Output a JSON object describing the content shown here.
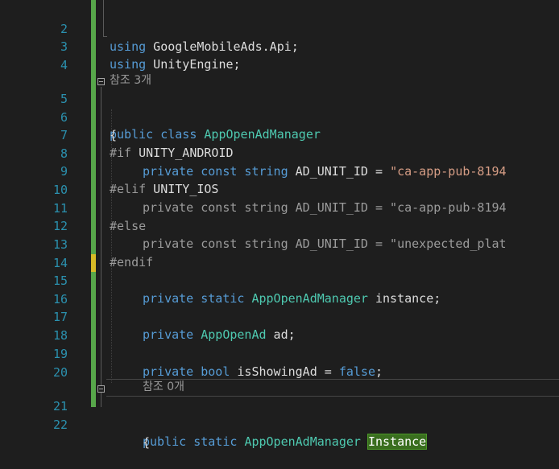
{
  "colors": {
    "background": "#1e1e1e",
    "line_number": "#2b91af",
    "keyword": "#569cd6",
    "type": "#4ec9b0",
    "string": "#d69d85",
    "preprocessor": "#9b9b9b",
    "saved_change": "#57a64a",
    "unsaved_change": "#d7ba26",
    "highlight": "#3a6e1f"
  },
  "editor": {
    "line_numbers": [
      "2",
      "3",
      "4",
      "5",
      "6",
      "7",
      "8",
      "9",
      "10",
      "11",
      "12",
      "13",
      "14",
      "15",
      "16",
      "17",
      "18",
      "19",
      "20",
      "21",
      "22"
    ],
    "ref_count_3": "참조 3개",
    "ref_count_0": "참조 0개",
    "l2": {
      "kw": "using",
      "rest": " GoogleMobileAds.Api;"
    },
    "l3": {
      "kw": "using",
      "rest": " UnityEngine;"
    },
    "l5": {
      "kw1": "public",
      "kw2": " class ",
      "type": "AppOpenAdManager"
    },
    "l6": {
      "text": "{"
    },
    "l7": {
      "pp": "#if",
      "rest": " UNITY_ANDROID"
    },
    "l8": {
      "kw1": "private",
      "kw2": " const",
      "kw3": " string",
      "rest": " AD_UNIT_ID = ",
      "str": "\"ca-app-pub-8194"
    },
    "l9": {
      "pp": "#elif",
      "rest": " UNITY_IOS"
    },
    "l10": {
      "text": "private const string AD_UNIT_ID = \"ca-app-pub-8194"
    },
    "l11": {
      "pp": "#else"
    },
    "l12": {
      "text": "private const string AD_UNIT_ID = \"unexpected_plat"
    },
    "l13": {
      "pp": "#endif"
    },
    "l15": {
      "kw1": "private",
      "kw2": " static ",
      "type": "AppOpenAdManager",
      "rest": " instance;"
    },
    "l17": {
      "kw1": "private",
      "type": " AppOpenAd",
      "rest": " ad;"
    },
    "l19": {
      "kw1": "private",
      "kw2": " bool",
      "rest": " isShowingAd = ",
      "kw3": "false",
      "rest2": ";"
    },
    "l21": {
      "kw1": "public",
      "kw2": " static ",
      "type": "AppOpenAdManager",
      "sp": " ",
      "highlight": "Instance"
    },
    "l22": {
      "text": "{"
    }
  }
}
